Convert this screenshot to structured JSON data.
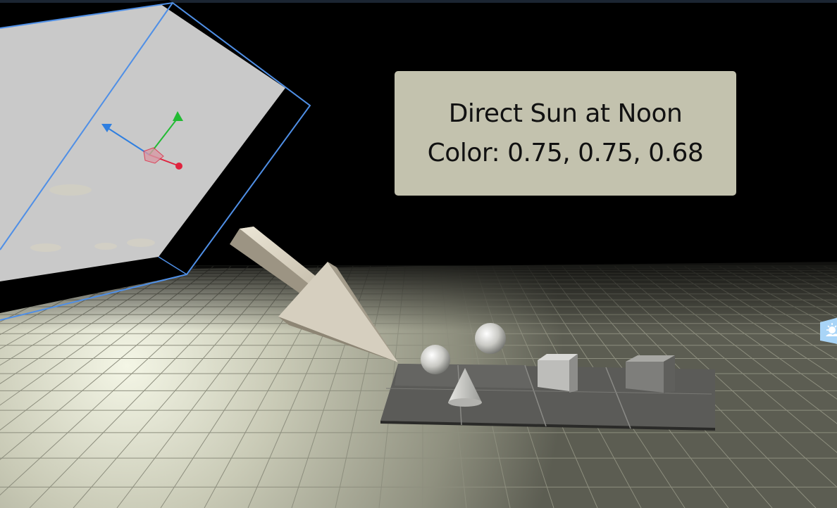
{
  "info_panel": {
    "title": "Direct Sun at Noon",
    "color_line": "Color: 0.75, 0.75, 0.68"
  },
  "colors": {
    "background": "#000000",
    "floor": "#b8b9a4",
    "floor_grid": "#8d8e7e",
    "panel_background": "#c3c2ae",
    "panel_text": "#111111",
    "selection_outline": "#4f8fe6",
    "sun_arrow": "#cfc7b6",
    "gizmo_x": "#e0233e",
    "gizmo_y": "#22bb33",
    "gizmo_z": "#2f7fe0",
    "side_badge": "#a8d4f7"
  },
  "icons": {
    "gizmo": "transform-gizmo-icon",
    "side_badge": "weather-sun-icon"
  }
}
